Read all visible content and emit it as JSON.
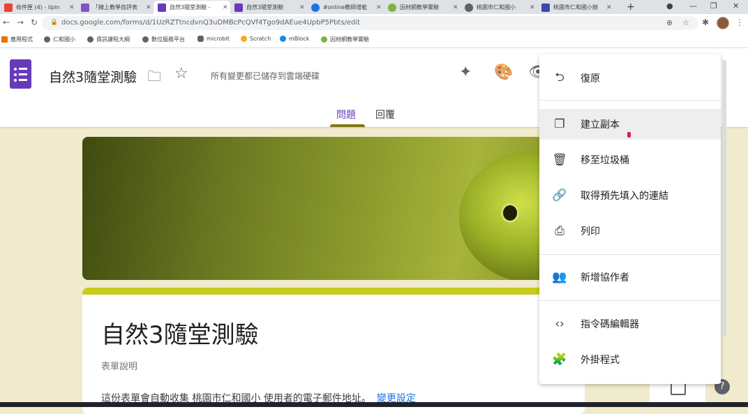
{
  "browser": {
    "tabs": [
      {
        "label": "收件匣 (4) - lipin",
        "icon_color": "#ea4335",
        "active": false
      },
      {
        "label": "「線上教學自評表",
        "icon_color": "#7e57c2",
        "active": false
      },
      {
        "label": "自然3隨堂測驗 -",
        "icon_color": "#673ab7",
        "active": true
      },
      {
        "label": "自然3隨堂測驗",
        "icon_color": "#673ab7",
        "active": false
      },
      {
        "label": "#online教師增能",
        "icon_color": "#1a73e8",
        "active": false
      },
      {
        "label": "因材網教學實驗",
        "icon_color": "#7cb342",
        "active": false
      },
      {
        "label": "桃園市仁和國小",
        "icon_color": "#5f6368",
        "active": false
      },
      {
        "label": "桃園市仁和國小辦",
        "icon_color": "#3949ab",
        "active": false
      }
    ],
    "new_tab": "+",
    "url": "docs.google.com/forms/d/1UzRZTtncdvnQ3uDMBcPcQVf4Tgo9dAEue4UpbP5Pbts/edit",
    "bookmarks": [
      "應用程式",
      "仁和國小",
      "資訊課程大綱",
      "數位服務平台",
      "microbit",
      "Scratch",
      "mBlock",
      "因材網教學實驗"
    ]
  },
  "header": {
    "title": "自然3隨堂測驗",
    "saved_status": "所有變更都已儲存到雲端硬碟"
  },
  "form_tabs": [
    {
      "label": "問題",
      "active": true
    },
    {
      "label": "回覆",
      "active": false
    }
  ],
  "form": {
    "title": "自然3隨堂測驗",
    "description": "表單說明",
    "notice": "這份表單會自動收集 桃園市仁和國小 使用者的電子郵件地址。",
    "change_link": "變更設定",
    "theme_color": "#c7cc1b"
  },
  "menu": {
    "items": [
      {
        "label": "復原",
        "icon": "undo-icon",
        "glyph": "⮌"
      },
      {
        "label": "建立副本",
        "icon": "copy-icon",
        "glyph": "❐"
      },
      {
        "label": "移至垃圾桶",
        "icon": "trash-icon",
        "glyph": "🗑"
      },
      {
        "label": "取得預先填入的連結",
        "icon": "link-icon",
        "glyph": "🔗"
      },
      {
        "label": "列印",
        "icon": "print-icon",
        "glyph": "⎙"
      },
      {
        "label": "新增協作者",
        "icon": "add-collaborator-icon",
        "glyph": "👥"
      },
      {
        "label": "指令碼編輯器",
        "icon": "code-icon",
        "glyph": "‹›"
      },
      {
        "label": "外掛程式",
        "icon": "addon-icon",
        "glyph": "🧩"
      }
    ],
    "hovered_index": 1
  }
}
